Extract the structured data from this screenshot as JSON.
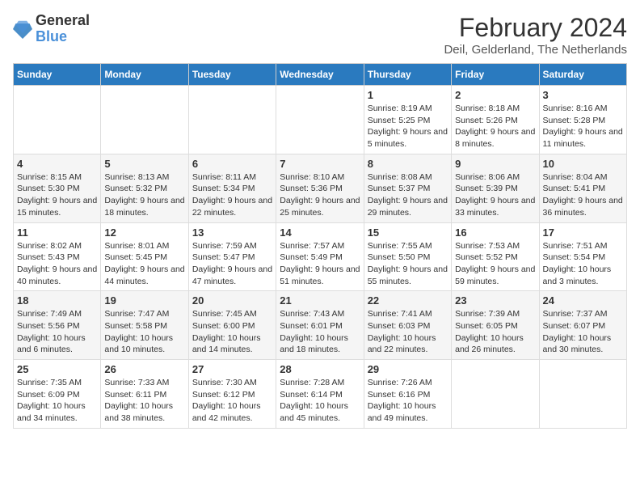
{
  "header": {
    "logo_line1": "General",
    "logo_line2": "Blue",
    "month_year": "February 2024",
    "location": "Deil, Gelderland, The Netherlands"
  },
  "weekdays": [
    "Sunday",
    "Monday",
    "Tuesday",
    "Wednesday",
    "Thursday",
    "Friday",
    "Saturday"
  ],
  "weeks": [
    [
      {
        "day": "",
        "info": ""
      },
      {
        "day": "",
        "info": ""
      },
      {
        "day": "",
        "info": ""
      },
      {
        "day": "",
        "info": ""
      },
      {
        "day": "1",
        "info": "Sunrise: 8:19 AM\nSunset: 5:25 PM\nDaylight: 9 hours\nand 5 minutes."
      },
      {
        "day": "2",
        "info": "Sunrise: 8:18 AM\nSunset: 5:26 PM\nDaylight: 9 hours\nand 8 minutes."
      },
      {
        "day": "3",
        "info": "Sunrise: 8:16 AM\nSunset: 5:28 PM\nDaylight: 9 hours\nand 11 minutes."
      }
    ],
    [
      {
        "day": "4",
        "info": "Sunrise: 8:15 AM\nSunset: 5:30 PM\nDaylight: 9 hours\nand 15 minutes."
      },
      {
        "day": "5",
        "info": "Sunrise: 8:13 AM\nSunset: 5:32 PM\nDaylight: 9 hours\nand 18 minutes."
      },
      {
        "day": "6",
        "info": "Sunrise: 8:11 AM\nSunset: 5:34 PM\nDaylight: 9 hours\nand 22 minutes."
      },
      {
        "day": "7",
        "info": "Sunrise: 8:10 AM\nSunset: 5:36 PM\nDaylight: 9 hours\nand 25 minutes."
      },
      {
        "day": "8",
        "info": "Sunrise: 8:08 AM\nSunset: 5:37 PM\nDaylight: 9 hours\nand 29 minutes."
      },
      {
        "day": "9",
        "info": "Sunrise: 8:06 AM\nSunset: 5:39 PM\nDaylight: 9 hours\nand 33 minutes."
      },
      {
        "day": "10",
        "info": "Sunrise: 8:04 AM\nSunset: 5:41 PM\nDaylight: 9 hours\nand 36 minutes."
      }
    ],
    [
      {
        "day": "11",
        "info": "Sunrise: 8:02 AM\nSunset: 5:43 PM\nDaylight: 9 hours\nand 40 minutes."
      },
      {
        "day": "12",
        "info": "Sunrise: 8:01 AM\nSunset: 5:45 PM\nDaylight: 9 hours\nand 44 minutes."
      },
      {
        "day": "13",
        "info": "Sunrise: 7:59 AM\nSunset: 5:47 PM\nDaylight: 9 hours\nand 47 minutes."
      },
      {
        "day": "14",
        "info": "Sunrise: 7:57 AM\nSunset: 5:49 PM\nDaylight: 9 hours\nand 51 minutes."
      },
      {
        "day": "15",
        "info": "Sunrise: 7:55 AM\nSunset: 5:50 PM\nDaylight: 9 hours\nand 55 minutes."
      },
      {
        "day": "16",
        "info": "Sunrise: 7:53 AM\nSunset: 5:52 PM\nDaylight: 9 hours\nand 59 minutes."
      },
      {
        "day": "17",
        "info": "Sunrise: 7:51 AM\nSunset: 5:54 PM\nDaylight: 10 hours\nand 3 minutes."
      }
    ],
    [
      {
        "day": "18",
        "info": "Sunrise: 7:49 AM\nSunset: 5:56 PM\nDaylight: 10 hours\nand 6 minutes."
      },
      {
        "day": "19",
        "info": "Sunrise: 7:47 AM\nSunset: 5:58 PM\nDaylight: 10 hours\nand 10 minutes."
      },
      {
        "day": "20",
        "info": "Sunrise: 7:45 AM\nSunset: 6:00 PM\nDaylight: 10 hours\nand 14 minutes."
      },
      {
        "day": "21",
        "info": "Sunrise: 7:43 AM\nSunset: 6:01 PM\nDaylight: 10 hours\nand 18 minutes."
      },
      {
        "day": "22",
        "info": "Sunrise: 7:41 AM\nSunset: 6:03 PM\nDaylight: 10 hours\nand 22 minutes."
      },
      {
        "day": "23",
        "info": "Sunrise: 7:39 AM\nSunset: 6:05 PM\nDaylight: 10 hours\nand 26 minutes."
      },
      {
        "day": "24",
        "info": "Sunrise: 7:37 AM\nSunset: 6:07 PM\nDaylight: 10 hours\nand 30 minutes."
      }
    ],
    [
      {
        "day": "25",
        "info": "Sunrise: 7:35 AM\nSunset: 6:09 PM\nDaylight: 10 hours\nand 34 minutes."
      },
      {
        "day": "26",
        "info": "Sunrise: 7:33 AM\nSunset: 6:11 PM\nDaylight: 10 hours\nand 38 minutes."
      },
      {
        "day": "27",
        "info": "Sunrise: 7:30 AM\nSunset: 6:12 PM\nDaylight: 10 hours\nand 42 minutes."
      },
      {
        "day": "28",
        "info": "Sunrise: 7:28 AM\nSunset: 6:14 PM\nDaylight: 10 hours\nand 45 minutes."
      },
      {
        "day": "29",
        "info": "Sunrise: 7:26 AM\nSunset: 6:16 PM\nDaylight: 10 hours\nand 49 minutes."
      },
      {
        "day": "",
        "info": ""
      },
      {
        "day": "",
        "info": ""
      }
    ]
  ]
}
